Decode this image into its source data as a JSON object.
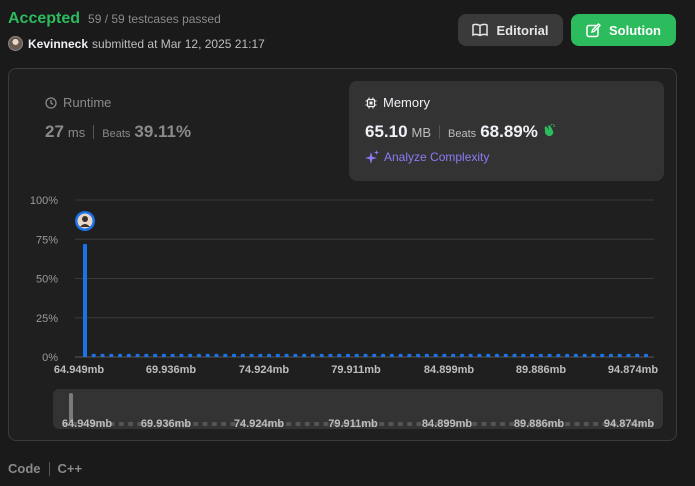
{
  "header": {
    "status": "Accepted",
    "testcases": "59 / 59 testcases passed",
    "username": "Kevinneck",
    "submitted_text": "submitted at Mar 12, 2025 21:17"
  },
  "buttons": {
    "editorial": "Editorial",
    "solution": "Solution"
  },
  "runtime": {
    "title": "Runtime",
    "value": "27",
    "unit": "ms",
    "beats_label": "Beats",
    "beats_value": "39.11%"
  },
  "memory": {
    "title": "Memory",
    "value": "65.10",
    "unit": "MB",
    "beats_label": "Beats",
    "beats_value": "68.89%",
    "analyze_label": "Analyze Complexity"
  },
  "chart_data": {
    "type": "bar",
    "y_ticks": [
      "100%",
      "75%",
      "50%",
      "25%",
      "0%"
    ],
    "ylim": [
      0,
      100
    ],
    "x_ticks": [
      "64.949mb",
      "69.936mb",
      "74.924mb",
      "79.911mb",
      "84.899mb",
      "89.886mb",
      "94.874mb"
    ],
    "values": [
      72,
      2,
      2,
      2,
      2,
      2,
      2,
      2,
      2,
      2,
      2,
      2,
      2,
      2,
      2,
      2,
      2,
      2,
      2,
      2,
      2,
      2,
      2,
      2,
      2,
      2,
      2,
      2,
      2,
      2,
      2,
      2,
      2,
      2,
      2,
      2,
      2,
      2,
      2,
      2,
      2,
      2,
      2,
      2,
      2,
      2,
      2,
      2,
      2,
      2,
      2,
      2,
      2,
      2,
      2,
      2,
      2,
      2,
      2,
      2,
      2,
      2,
      2,
      2,
      2
    ],
    "bar_color": "#1a73e8",
    "grid": true
  },
  "navigator": {
    "x_ticks": [
      "64.949mb",
      "69.936mb",
      "74.924mb",
      "79.911mb",
      "84.899mb",
      "89.886mb",
      "94.874mb"
    ]
  },
  "footer": {
    "code_label": "Code",
    "language": "C++"
  },
  "colors": {
    "accent_green": "#2cbb5d",
    "bar_blue": "#1a73e8",
    "analyze_purple": "#8b7cf6",
    "yellow": "#ffc01e"
  }
}
